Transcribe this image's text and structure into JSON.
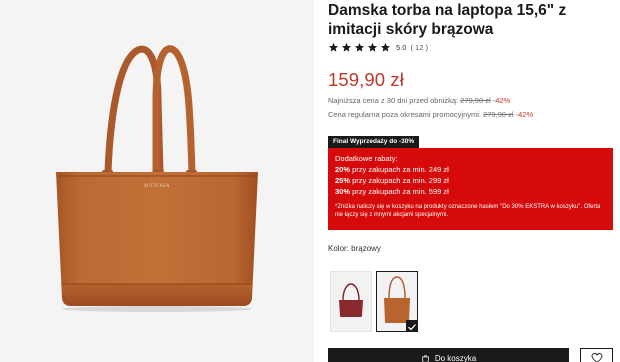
{
  "product": {
    "title": "Damska torba na laptopa 15,6\" z imitacji skóry brązowa",
    "brand_mark": "WITTCHEN",
    "rating": {
      "value": "5.0",
      "count": "( 12 )",
      "stars": 5
    },
    "price": "159,90 zł",
    "lowest_price": {
      "label": "Najniższa cena z 30 dni przed obniżką:",
      "old": "279,90 zł",
      "discount": "-42%"
    },
    "regular_price": {
      "label": "Cena regularna poza okresami promocyjnymi:",
      "old": "279,90 zł",
      "discount": "-42%"
    }
  },
  "promo": {
    "tag": "Final Wyprzedaży do -30%",
    "heading": "Dodatkowe rabaty:",
    "tiers": [
      {
        "percent": "20%",
        "text": " przy zakupach za min. 249 zł"
      },
      {
        "percent": "25%",
        "text": " przy zakupach za min. 299 zł"
      },
      {
        "percent": "30%",
        "text": " przy zakupach za min. 599 zł"
      }
    ],
    "note": "*Zniżka naliczy się w koszyku na produkty oznaczone hasłem \"Do 30% EKSTRA w koszyku\". Oferta nie łączy się z innymi akcjami specjalnymi."
  },
  "color": {
    "label": "Kolor:",
    "value": "brązowy"
  },
  "swatches": [
    {
      "name": "bordowy",
      "color": "#8a2a2e",
      "selected": false
    },
    {
      "name": "brązowy",
      "color": "#b8642e",
      "selected": true
    }
  ],
  "buy": {
    "label": "Do koszyka"
  },
  "colors": {
    "accent_red": "#d60a0a",
    "price_red": "#c0392b",
    "bag_brown": "#b8642e",
    "dark": "#1a1a1a"
  },
  "icons": {
    "star": "star-icon",
    "heart": "heart-icon",
    "check": "check-icon",
    "bag": "shopping-bag-icon"
  }
}
